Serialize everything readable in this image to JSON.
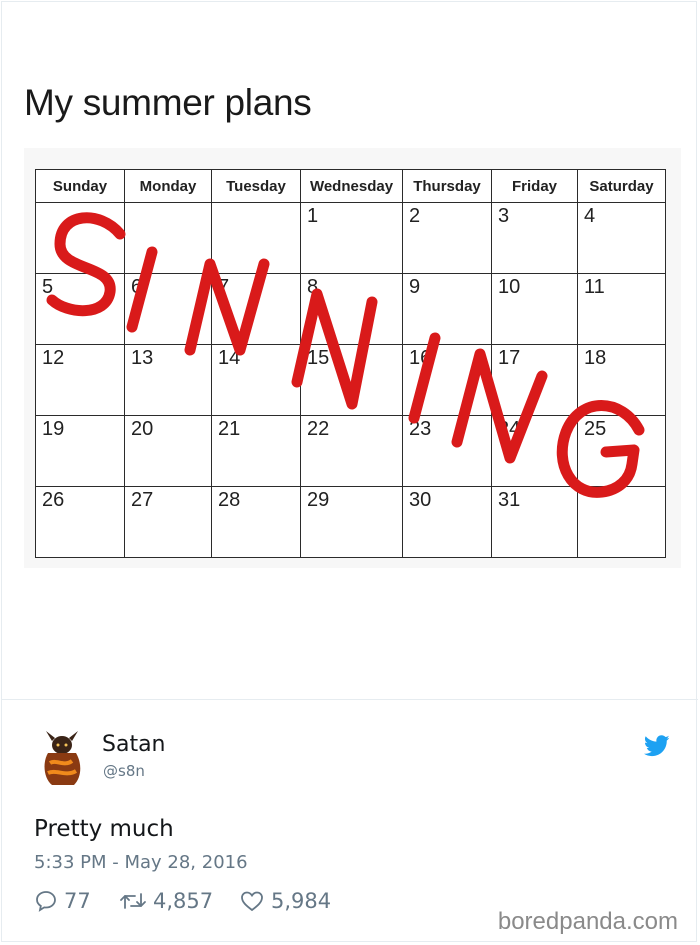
{
  "meme": {
    "title": "My summer plans",
    "calendar": {
      "days": [
        "Sunday",
        "Monday",
        "Tuesday",
        "Wednesday",
        "Thursday",
        "Friday",
        "Saturday"
      ],
      "weeks": [
        [
          "",
          "",
          "",
          "1",
          "2",
          "3",
          "4"
        ],
        [
          "5",
          "6",
          "7",
          "8",
          "9",
          "10",
          "11"
        ],
        [
          "12",
          "13",
          "14",
          "15",
          "16",
          "17",
          "18"
        ],
        [
          "19",
          "20",
          "21",
          "22",
          "23",
          "24",
          "25"
        ],
        [
          "26",
          "27",
          "28",
          "29",
          "30",
          "31",
          ""
        ]
      ]
    },
    "overlay_word": "SINNING",
    "overlay_color": "#d91a1a"
  },
  "tweet": {
    "author_name": "Satan",
    "author_handle": "@s8n",
    "text": "Pretty much",
    "timestamp": "5:33 PM - May 28, 2016",
    "replies": "77",
    "retweets": "4,857",
    "likes": "5,984",
    "bird_color": "#1da1f2",
    "icons": [
      "twitter-bird-icon",
      "reply-icon",
      "retweet-icon",
      "heart-icon"
    ]
  },
  "watermark": "boredpanda.com"
}
